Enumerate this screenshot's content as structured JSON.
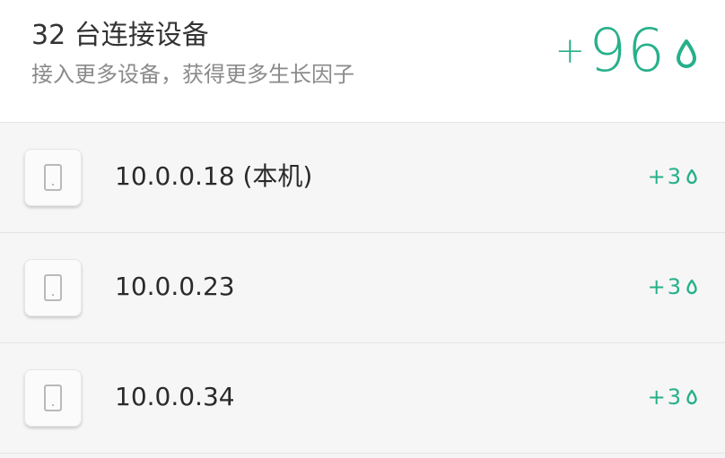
{
  "header": {
    "title": "32 台连接设备",
    "subtitle": "接入更多设备，获得更多生长因子",
    "total_plus": "+",
    "total_value": "96",
    "total_icon": "water-drop-icon",
    "accent_color": "#26b08a"
  },
  "devices": [
    {
      "ip": "10.0.0.18 (本机)",
      "reward": "+3",
      "icon": "phone-icon",
      "reward_icon": "water-drop-icon"
    },
    {
      "ip": "10.0.0.23",
      "reward": "+3",
      "icon": "phone-icon",
      "reward_icon": "water-drop-icon"
    },
    {
      "ip": "10.0.0.34",
      "reward": "+3",
      "icon": "phone-icon",
      "reward_icon": "water-drop-icon"
    }
  ]
}
